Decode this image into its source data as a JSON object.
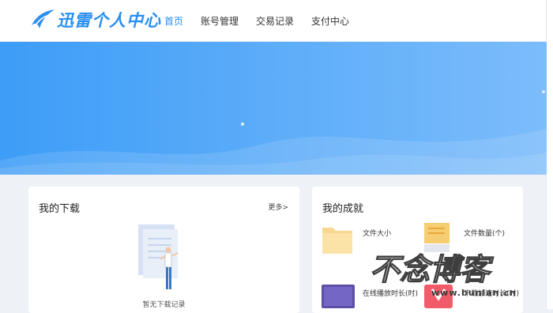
{
  "header": {
    "logo_text": "迅雷个人中心",
    "nav": [
      {
        "label": "首页",
        "active": true
      },
      {
        "label": "账号管理",
        "active": false
      },
      {
        "label": "交易记录",
        "active": false
      },
      {
        "label": "支付中心",
        "active": false
      }
    ]
  },
  "downloads": {
    "title": "我的下载",
    "more_label": "更多>",
    "empty_text": "暂无下载记录"
  },
  "achievements": {
    "title": "我的成就",
    "items": [
      {
        "label": "文件大小",
        "icon": "folder-icon"
      },
      {
        "label": "文件数量(个)",
        "icon": "document-stack-icon"
      },
      {
        "label": "在线播放时长(时)",
        "icon": "video-screen-icon"
      },
      {
        "label": "下载加速时长(时)",
        "icon": "speed-icon"
      }
    ]
  },
  "watermark": {
    "text": "不念博客",
    "sub": "www.bunian.cn"
  },
  "colors": {
    "accent": "#2a8ff0",
    "banner_start": "#3d9df7",
    "banner_end": "#7cbcfb",
    "page_bg": "#eef1f6"
  }
}
